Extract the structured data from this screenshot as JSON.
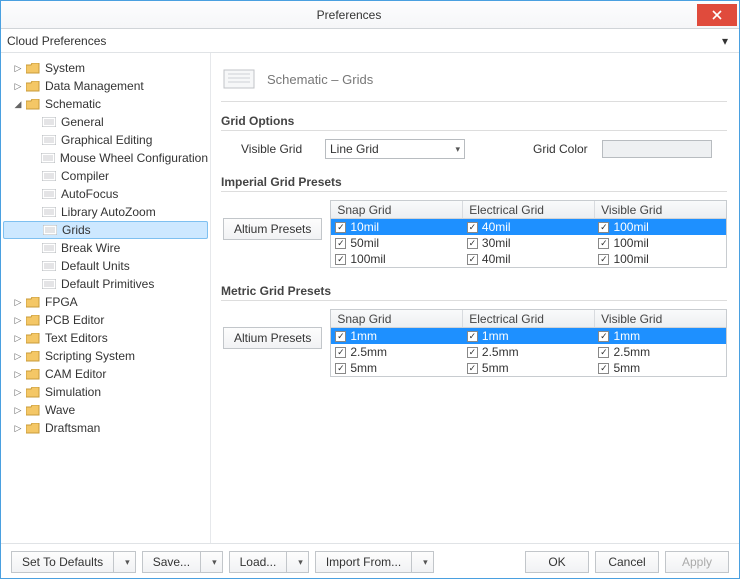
{
  "window": {
    "title": "Preferences"
  },
  "cloud": {
    "label": "Cloud Preferences"
  },
  "tree": {
    "system": "System",
    "data_mgmt": "Data Management",
    "schematic": "Schematic",
    "general": "General",
    "graphical_editing": "Graphical Editing",
    "mouse_wheel": "Mouse Wheel Configuration",
    "compiler": "Compiler",
    "autofocus": "AutoFocus",
    "library_autozoom": "Library AutoZoom",
    "grids": "Grids",
    "break_wire": "Break Wire",
    "default_units": "Default Units",
    "default_primitives": "Default Primitives",
    "fpga": "FPGA",
    "pcb_editor": "PCB Editor",
    "text_editors": "Text Editors",
    "scripting": "Scripting System",
    "cam_editor": "CAM Editor",
    "simulation": "Simulation",
    "wave": "Wave",
    "draftsman": "Draftsman"
  },
  "header": {
    "title": "Schematic – Grids"
  },
  "grid_options": {
    "title": "Grid Options",
    "visible_grid_label": "Visible Grid",
    "visible_grid_value": "Line Grid",
    "grid_color_label": "Grid Color",
    "grid_color": "#eef0f2"
  },
  "imperial": {
    "title": "Imperial Grid Presets",
    "preset_btn": "Altium Presets",
    "columns": {
      "snap": "Snap Grid",
      "elec": "Electrical Grid",
      "vis": "Visible Grid"
    },
    "rows": [
      {
        "snap": "10mil",
        "elec": "40mil",
        "vis": "100mil",
        "snap_chk": true,
        "elec_chk": true,
        "vis_chk": true
      },
      {
        "snap": "50mil",
        "elec": "30mil",
        "vis": "100mil",
        "snap_chk": true,
        "elec_chk": true,
        "vis_chk": true
      },
      {
        "snap": "100mil",
        "elec": "40mil",
        "vis": "100mil",
        "snap_chk": true,
        "elec_chk": true,
        "vis_chk": true
      }
    ]
  },
  "metric": {
    "title": "Metric Grid Presets",
    "preset_btn": "Altium Presets",
    "columns": {
      "snap": "Snap Grid",
      "elec": "Electrical Grid",
      "vis": "Visible Grid"
    },
    "rows": [
      {
        "snap": "1mm",
        "elec": "1mm",
        "vis": "1mm",
        "snap_chk": true,
        "elec_chk": true,
        "vis_chk": true
      },
      {
        "snap": "2.5mm",
        "elec": "2.5mm",
        "vis": "2.5mm",
        "snap_chk": true,
        "elec_chk": true,
        "vis_chk": true
      },
      {
        "snap": "5mm",
        "elec": "5mm",
        "vis": "5mm",
        "snap_chk": true,
        "elec_chk": true,
        "vis_chk": true
      }
    ]
  },
  "buttons": {
    "set_defaults": "Set To Defaults",
    "save": "Save...",
    "load": "Load...",
    "import_from": "Import From...",
    "ok": "OK",
    "cancel": "Cancel",
    "apply": "Apply"
  }
}
